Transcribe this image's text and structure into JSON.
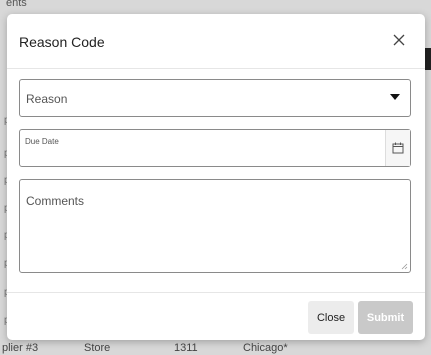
{
  "background": {
    "top_text": "ents",
    "left_letters": [
      "p",
      "p",
      "p",
      "p",
      "p",
      "p",
      "p",
      "p",
      "p",
      "p",
      "p"
    ],
    "row": {
      "supplier": "plier #3",
      "type": "Store",
      "number": "1311",
      "city": "Chicago*"
    }
  },
  "modal": {
    "title": "Reason Code",
    "close_icon": "close-icon",
    "reason": {
      "placeholder": "Reason",
      "icon": "chevron-down-icon"
    },
    "due_date": {
      "label": "Due Date",
      "value": "",
      "icon": "calendar-icon"
    },
    "comments": {
      "label": "Comments",
      "value": ""
    },
    "buttons": {
      "close": "Close",
      "submit": "Submit"
    }
  },
  "colors": {
    "border": "#8a8a8a",
    "submit_disabled": "#c9c9c9",
    "close_btn": "#ececec"
  }
}
